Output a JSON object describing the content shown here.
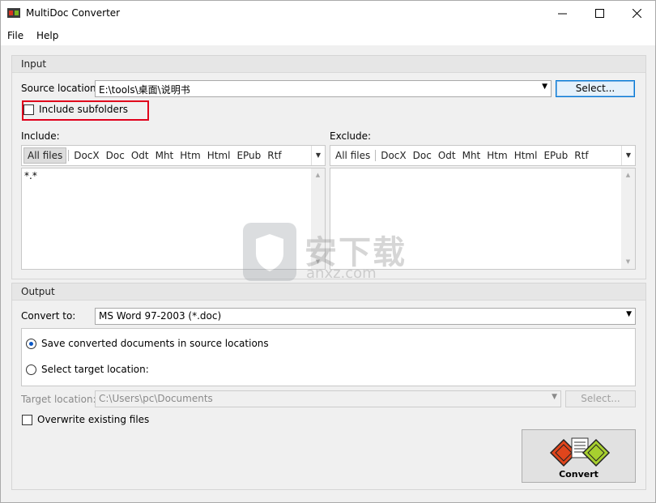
{
  "window": {
    "title": "MultiDoc Converter"
  },
  "menu": [
    "File",
    "Help"
  ],
  "input": {
    "title": "Input",
    "source_label": "Source location:",
    "source_value": "E:\\tools\\桌面\\说明书",
    "select_button": "Select...",
    "include_subfolders": "Include subfolders",
    "include_label": "Include:",
    "exclude_label": "Exclude:",
    "include_tabs": [
      "All files",
      "DocX",
      "Doc",
      "Odt",
      "Mht",
      "Htm",
      "Html",
      "EPub",
      "Rtf"
    ],
    "exclude_tabs": [
      "All files",
      "DocX",
      "Doc",
      "Odt",
      "Mht",
      "Htm",
      "Html",
      "EPub",
      "Rtf"
    ],
    "include_pattern": "*.*"
  },
  "output": {
    "title": "Output",
    "convert_to_label": "Convert to:",
    "convert_to_value": "MS Word 97-2003 (*.doc)",
    "radio_source": "Save converted documents in source locations",
    "radio_target": "Select target location:",
    "target_label": "Target location:",
    "target_value": "C:\\Users\\pc\\Documents",
    "target_select_button": "Select...",
    "overwrite": "Overwrite existing files"
  },
  "convert_button": "Convert",
  "watermark": {
    "text": "安下载",
    "url": "anxz.com"
  }
}
